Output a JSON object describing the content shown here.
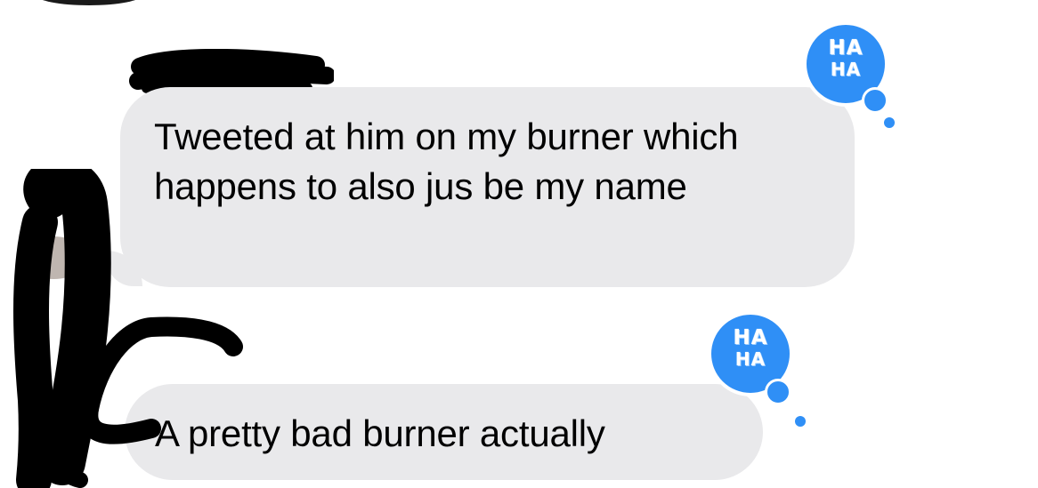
{
  "thread": {
    "messages": [
      {
        "text": "Tweeted at him on my burner which happens to also jus be my name",
        "reaction": {
          "label_line1": "HA",
          "label_line2": "HA",
          "icon": "haha-reaction-icon"
        }
      },
      {
        "text": "A pretty bad burner actually",
        "reaction": {
          "label_line1": "HA",
          "label_line2": "HA",
          "icon": "haha-reaction-icon"
        }
      }
    ]
  },
  "colors": {
    "incoming_bubble": "#e9e9eb",
    "reaction_blue": "#2f8ff6",
    "redaction": "#000000",
    "background": "#ffffff"
  }
}
